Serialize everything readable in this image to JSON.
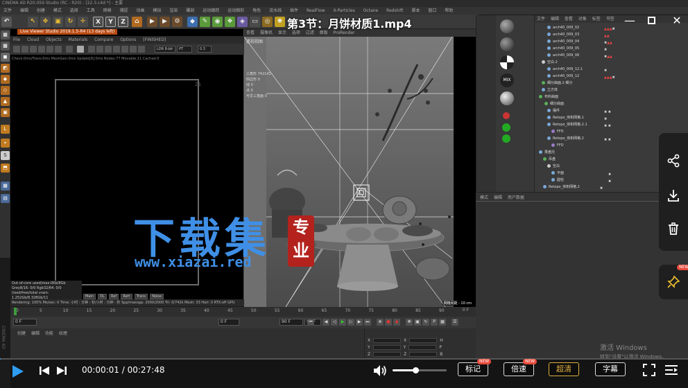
{
  "video": {
    "title": "第3节：月饼材质1.mp4",
    "current_time": "00:00:01",
    "total_time": "00:27:48",
    "time_separator": " / ",
    "progress": 0.001,
    "volume": 0.42
  },
  "window_controls": {
    "minimize": "—",
    "close": "✕"
  },
  "player_buttons": {
    "notes": "标记",
    "speed": "倍速",
    "quality": "超清",
    "subtitles": "字幕",
    "new_badge": "NEW",
    "side_new_badge": "NEW"
  },
  "watermark": {
    "big_text": "下载集",
    "seal_text_1": "专",
    "seal_text_2": "业",
    "url": "www.xiazai.red"
  },
  "windows_activation": {
    "line1": "激活 Windows",
    "line2": "转到\"设置\"以激活 Windows。"
  },
  "c4d": {
    "title_bar": "CINEMA 4D R20.059 Studio (RC - R20) - [22.3.c4d *] - 主要",
    "menu": [
      "文件",
      "编辑",
      "创建",
      "模式",
      "选择",
      "工具",
      "网格",
      "捕捉",
      "动画",
      "模拟",
      "渲染",
      "雕刻",
      "运动跟踪",
      "运动图形",
      "角色",
      "流水线",
      "插件",
      "RealFlow",
      "X-Particles",
      "Octane",
      "Redshift",
      "脚本",
      "窗口",
      "帮助"
    ],
    "side_label": "CINEMA 4D"
  },
  "picture_viewer": {
    "title": "Live Viewer Studio 2019.1.5-R4 (13 days left)",
    "menu": [
      "File",
      "Cloud",
      "Objects",
      "Materials",
      "Compare",
      "Options",
      "[FINISHED]"
    ],
    "select_ldr": "LDR 8-bit",
    "select_pt": "PT",
    "select_val": "0.3",
    "status_line": "Check:0ms/Trans:0ms  MeshGen:0ms  Update[8]:0ms  Nodes:77  Movable:11  Cached:0",
    "frame_label": "Z1",
    "info_lines": [
      "Out-of-core used/max:0Kb/8Gb",
      "Grey8/16: 0/0        Rgb32/64: 0/0",
      "Used/free/total vram: 1.252Gb/8.328Gb/11"
    ],
    "tabs": [
      "Main",
      "DL",
      "Ref",
      "Refr",
      "Trans",
      "Noise"
    ],
    "render_line": "Rendering: 100%   Ms/sec: 0   Time: 小时 : 分钟 : 秒/小时 : 分钟 : 秒   Spp/maxspp: 2000/2000   Tri: 0/742k   Mesh: 33   Hair: 0   RTX:off   GPU"
  },
  "viewport": {
    "menu": [
      "查看",
      "摄像机",
      "显示",
      "选项",
      "过滤",
      "面板",
      "ProRender"
    ],
    "label": "透视视图",
    "stats": [
      "三角形    742141",
      "四边形    0",
      "线         0",
      "点         0",
      "可见三角面  0"
    ],
    "grid_label": "网格间距 : 10 cm"
  },
  "object_manager": {
    "tabs": [
      "文件",
      "编辑",
      "查看",
      "对象",
      "标签",
      "书签"
    ],
    "rows": [
      "arch40_009_02",
      "arch40_009_03",
      "arch40_009_04",
      "arch40_009_05",
      "arch40_009_06",
      "空白.2",
      "arch40_009_12.1",
      "arch40_009_12",
      "细分曲面.2 细分",
      "立方体",
      "布料曲面",
      "细分曲面",
      "摆件",
      "Retopo_体积网格.1",
      "Retopo_体积网格.2.1",
      "FFD",
      "Retopo_体积网格.2",
      "FFD",
      "果盘托",
      "吊盘",
      "空白",
      "平面",
      "圆柱",
      "Retopo_体积网格.2"
    ]
  },
  "attributes": {
    "tabs": [
      "模式",
      "编辑",
      "用户数据"
    ]
  },
  "timeline": {
    "ticks": [
      "0",
      "5",
      "10",
      "15",
      "20",
      "25",
      "30",
      "35",
      "40",
      "45",
      "50",
      "55",
      "60",
      "65",
      "70",
      "75",
      "80",
      "85",
      "90"
    ],
    "end_label": "0 F",
    "start_field": "0 F",
    "start_field2": "0 F",
    "end_field": "90 F",
    "end_field2": "90 F"
  },
  "material_manager": {
    "tabs": [
      "创建",
      "编辑",
      "功能",
      "纹理"
    ]
  },
  "coordinates": {
    "rows": [
      {
        "a": "X",
        "b": "X",
        "c": "H"
      },
      {
        "a": "Y",
        "b": "Y",
        "c": "P"
      },
      {
        "a": "Z",
        "b": "Z",
        "c": "B"
      }
    ]
  },
  "colors": {
    "accent_blue": "#2f9cf4",
    "watermark_blue": "#3f8fe6",
    "seal_red": "#b3221d",
    "badge_red": "#e84a3a",
    "quality_gold": "#e0b040"
  }
}
